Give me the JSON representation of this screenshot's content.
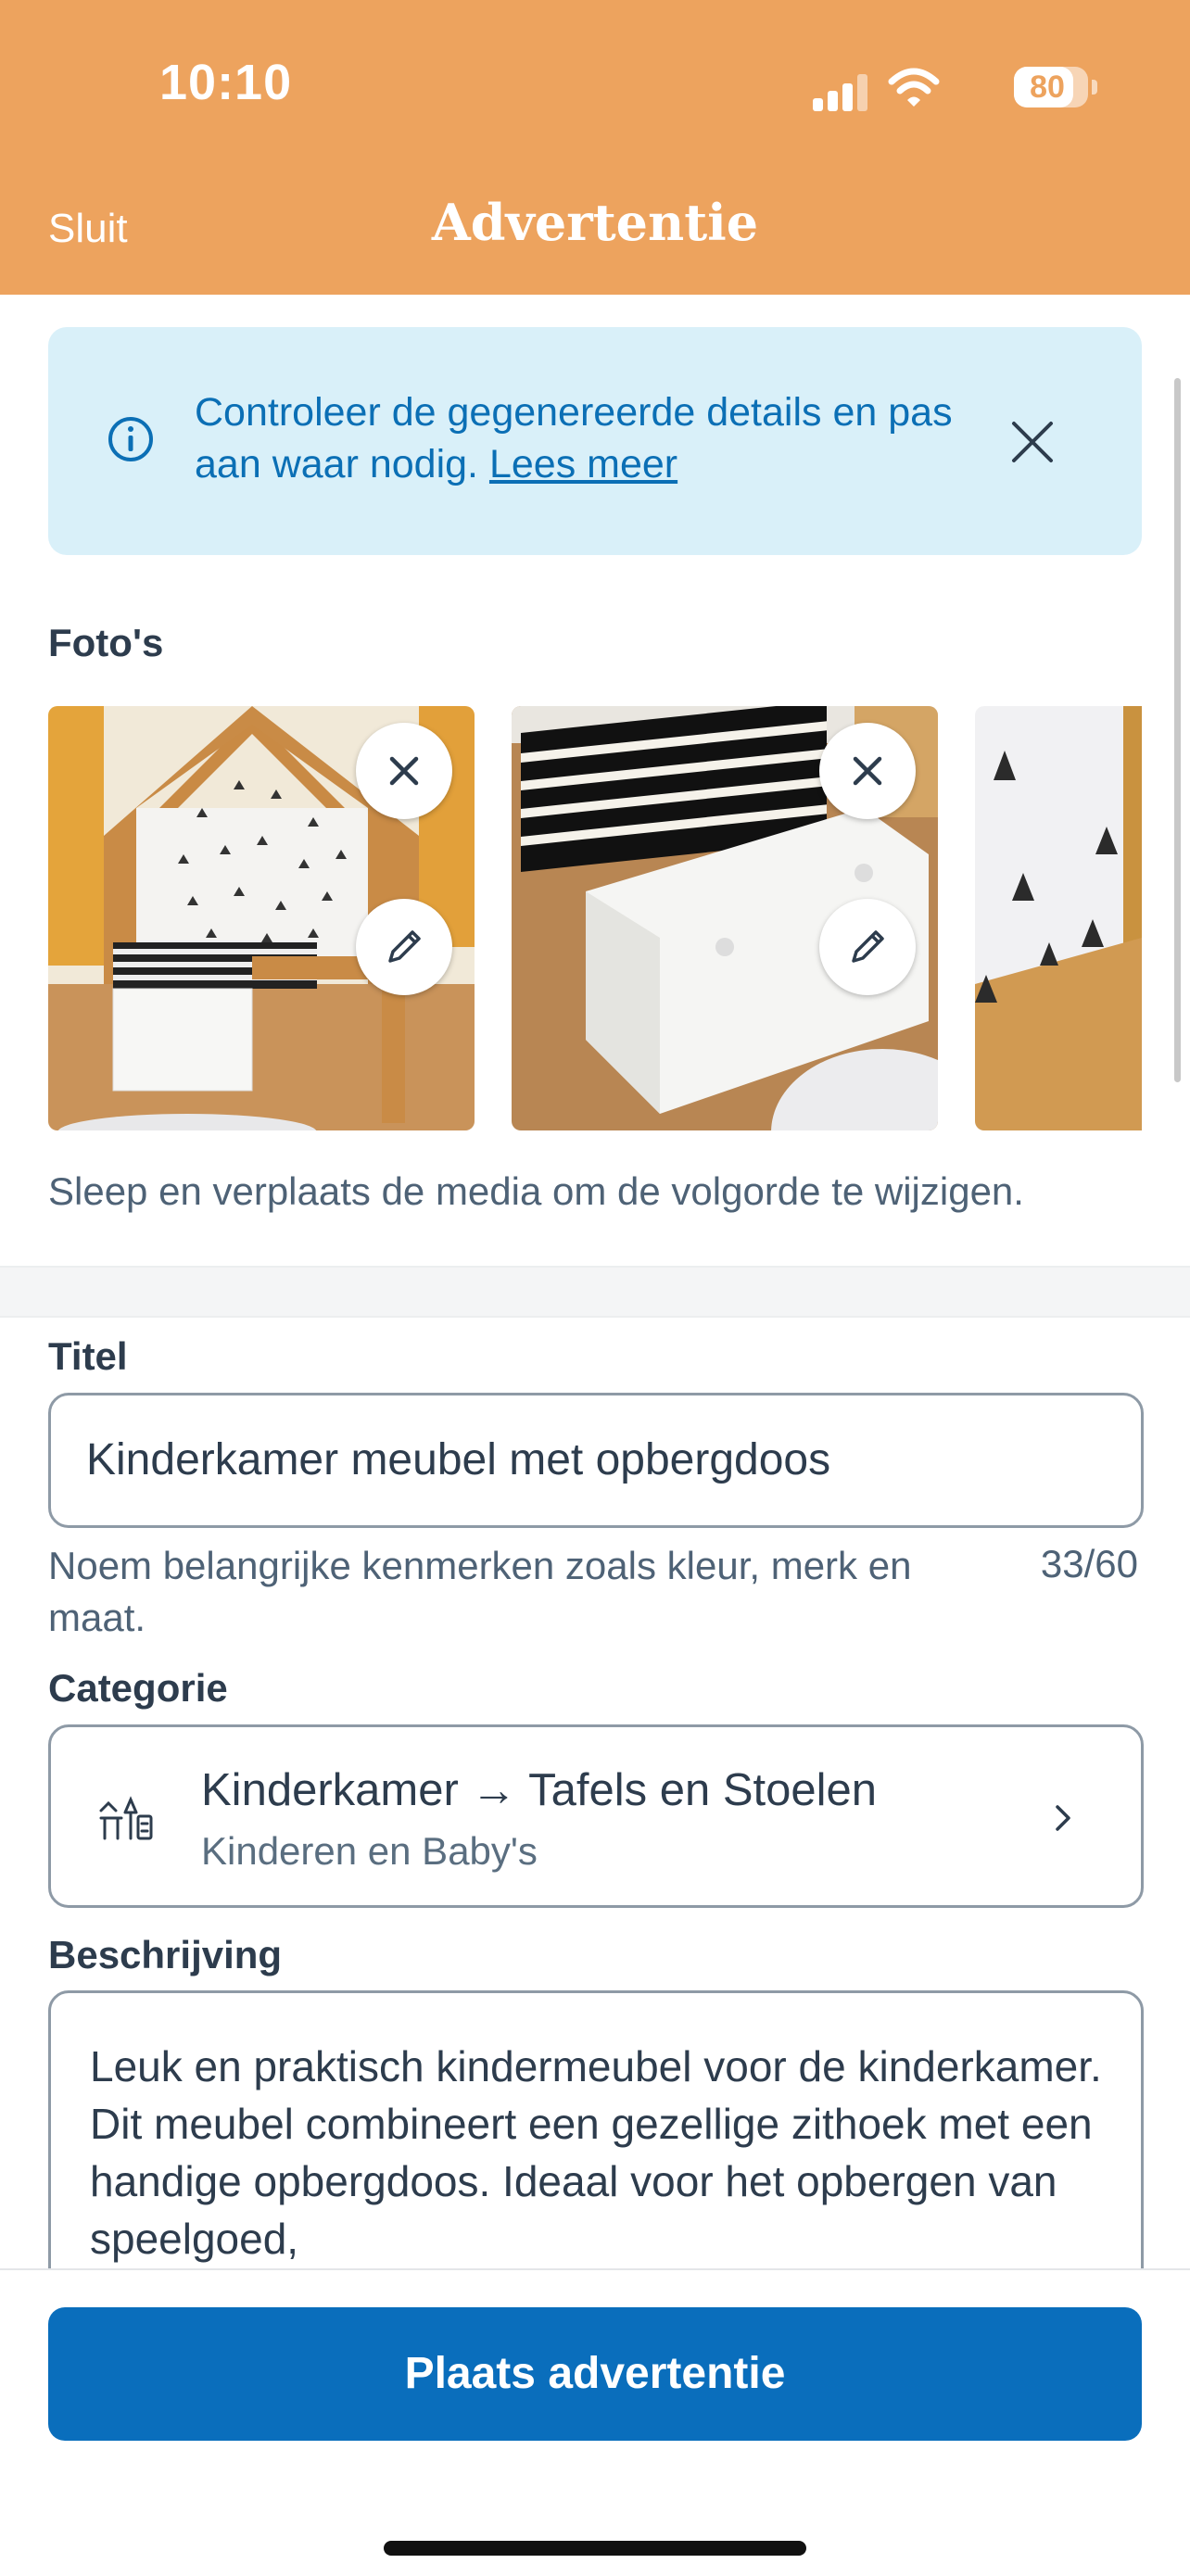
{
  "status_bar": {
    "time": "10:10",
    "battery": "80",
    "battery_level": 0.8
  },
  "header": {
    "close_label": "Sluit",
    "title": "Advertentie",
    "background_color": "#eda35e"
  },
  "info_banner": {
    "text": "Controleer de gegenereerde details en pas aan waar nodig.",
    "link": "Lees meer",
    "icon": "info-icon",
    "close_icon": "close-icon"
  },
  "photos": {
    "label": "Foto's",
    "items": [
      {
        "name": "photo-1",
        "remove_icon": "close-icon",
        "edit_icon": "pencil-icon"
      },
      {
        "name": "photo-2",
        "remove_icon": "close-icon",
        "edit_icon": "pencil-icon"
      },
      {
        "name": "photo-3"
      }
    ],
    "helper": "Sleep en verplaats de media om de volgorde te wijzigen."
  },
  "title_field": {
    "label": "Titel",
    "value": "Kinderkamer meubel met opbergdoos",
    "helper": "Noem belangrijke kenmerken zoals kleur, merk en maat.",
    "counter": "33/60"
  },
  "category_field": {
    "label": "Categorie",
    "main": "Kinderkamer → Tafels en Stoelen",
    "sub": "Kinderen en Baby's",
    "icon": "furniture-icon",
    "chevron": "chevron-right-icon"
  },
  "description_field": {
    "label": "Beschrijving",
    "value": "Leuk en praktisch kindermeubel voor de kinderkamer. Dit meubel combineert een gezellige zithoek met een handige opbergdoos. Ideaal voor het opbergen van speelgoed,"
  },
  "footer": {
    "cta_label": "Plaats advertentie",
    "cta_color": "#0a6ebc"
  }
}
